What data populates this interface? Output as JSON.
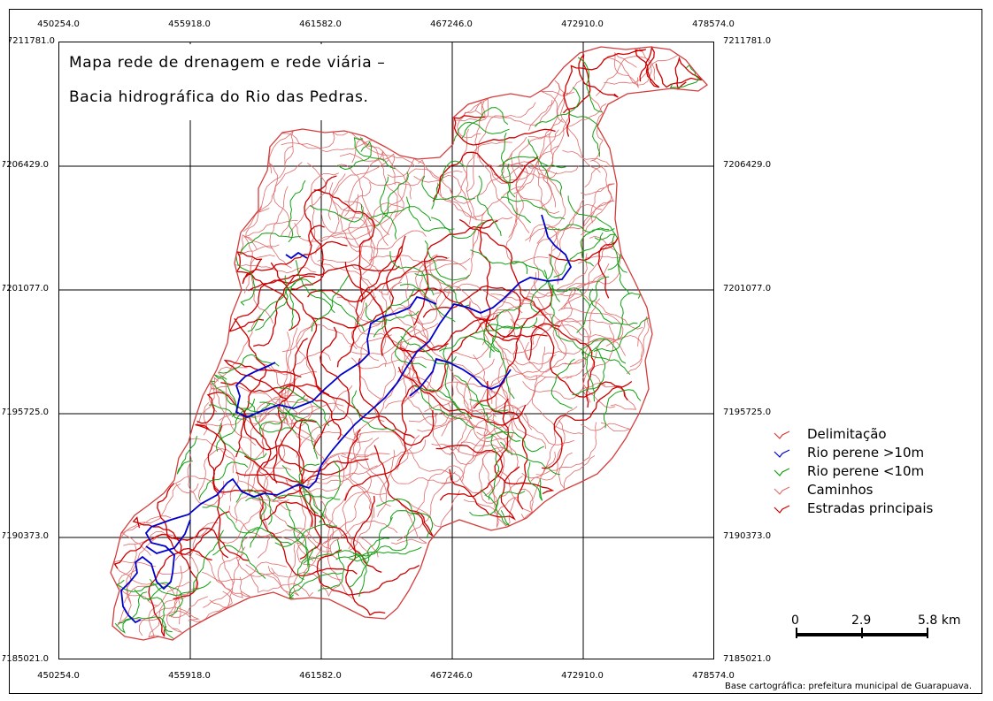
{
  "map": {
    "title_line1": "Mapa rede de drenagem e rede viária –",
    "title_line2": "Bacia hidrográfica do Rio das Pedras.",
    "x_labels": [
      "450254.0",
      "455918.0",
      "461582.0",
      "467246.0",
      "472910.0",
      "478574.0"
    ],
    "y_labels_left": [
      "7211781.0",
      "7206429.0",
      "7201077.0",
      "7195725.0",
      "7190373.0",
      "7185021.0"
    ],
    "y_labels_right": [
      "7211781.0",
      "7206429.0",
      "7201077.0",
      "7195725.0",
      "7190373.0",
      "7185021.0"
    ],
    "source": "Base cartográfica: prefeitura municipal de Guarapuava."
  },
  "legend": [
    {
      "label": "Delimitação",
      "color": "#d43c3c",
      "icon": "red-line-icon"
    },
    {
      "label": "Rio perene >10m",
      "color": "#0000cc",
      "icon": "blue-line-icon"
    },
    {
      "label": "Rio perene <10m",
      "color": "#10a010",
      "icon": "green-line-icon"
    },
    {
      "label": "Caminhos",
      "color": "#e07070",
      "icon": "pink-line-icon"
    },
    {
      "label": "Estradas principais",
      "color": "#cc0000",
      "icon": "red-line-icon"
    }
  ],
  "scale": {
    "labels": [
      "0",
      "2.9",
      "5.8 km"
    ]
  },
  "colors": {
    "paths": "#e06a6a",
    "main_roads": "#cc0000",
    "small_rivers": "#14a014",
    "big_river": "#0000cc"
  }
}
